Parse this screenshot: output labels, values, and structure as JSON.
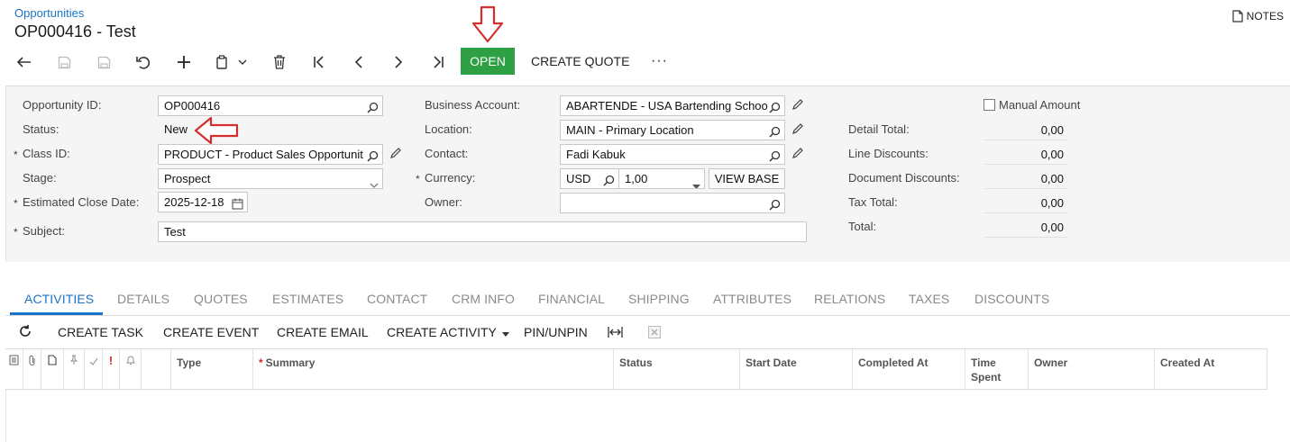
{
  "header": {
    "breadcrumb": "Opportunities",
    "title": "OP000416 - Test",
    "notes_label": "NOTES"
  },
  "toolbar": {
    "icons": [
      "back-arrow-icon",
      "save-icon",
      "save-close-icon",
      "undo-icon",
      "add-icon",
      "clipboard-icon",
      "chevron-down-icon",
      "delete-icon",
      "first-record-icon",
      "previous-record-icon",
      "next-record-icon",
      "last-record-icon",
      "more-icon"
    ],
    "open_label": "OPEN",
    "create_quote_label": "CREATE QUOTE",
    "more_label": "···"
  },
  "form": {
    "opportunity_id": {
      "label": "Opportunity ID:",
      "value": "OP000416"
    },
    "status": {
      "label": "Status:",
      "value": "New"
    },
    "class_id": {
      "label": "Class ID:",
      "value": "PRODUCT - Product Sales Opportunit"
    },
    "stage": {
      "label": "Stage:",
      "value": "Prospect"
    },
    "estimated_close_date": {
      "label": "Estimated Close Date:",
      "value": "2025-12-18"
    },
    "subject": {
      "label": "Subject:",
      "value": "Test"
    },
    "business_account": {
      "label": "Business Account:",
      "value": "ABARTENDE - USA Bartending Schoo"
    },
    "location": {
      "label": "Location:",
      "value": "MAIN - Primary Location"
    },
    "contact": {
      "label": "Contact:",
      "value": "Fadi Kabuk"
    },
    "currency": {
      "label": "Currency:",
      "code": "USD",
      "rate": "1,00",
      "view_base_label": "VIEW BASE"
    },
    "owner": {
      "label": "Owner:",
      "value": ""
    },
    "manual_amount": {
      "label": "Manual Amount",
      "checked": false
    },
    "totals": [
      {
        "label": "Detail Total:",
        "value": "0,00"
      },
      {
        "label": "Line Discounts:",
        "value": "0,00"
      },
      {
        "label": "Document Discounts:",
        "value": "0,00"
      },
      {
        "label": "Tax Total:",
        "value": "0,00"
      },
      {
        "label": "Total:",
        "value": "0,00"
      }
    ]
  },
  "tabs": [
    {
      "label": "ACTIVITIES",
      "active": true
    },
    {
      "label": "DETAILS"
    },
    {
      "label": "QUOTES"
    },
    {
      "label": "ESTIMATES"
    },
    {
      "label": "CONTACT"
    },
    {
      "label": "CRM INFO"
    },
    {
      "label": "FINANCIAL"
    },
    {
      "label": "SHIPPING"
    },
    {
      "label": "ATTRIBUTES"
    },
    {
      "label": "RELATIONS"
    },
    {
      "label": "TAXES"
    },
    {
      "label": "DISCOUNTS"
    }
  ],
  "grid_toolbar": {
    "create_task": "CREATE TASK",
    "create_event": "CREATE EVENT",
    "create_email": "CREATE EMAIL",
    "create_activity": "CREATE ACTIVITY",
    "pin_unpin": "PIN/UNPIN"
  },
  "grid": {
    "columns": [
      "Type",
      "Summary",
      "Status",
      "Start Date",
      "Completed At",
      "Time Spent",
      "Owner",
      "Created At"
    ],
    "time_spent_lines": [
      "Time",
      "Spent"
    ]
  },
  "colors": {
    "accent": "#1a73c8",
    "open_button": "#2ea043",
    "annotation_arrow": "#d32f2f"
  }
}
